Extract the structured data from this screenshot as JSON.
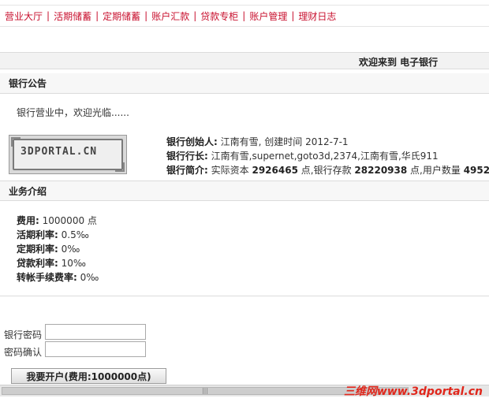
{
  "nav": {
    "items": [
      "营业大厅",
      "活期储蓄",
      "定期储蓄",
      "账户汇款",
      "贷款专柜",
      "账户管理",
      "理财日志"
    ],
    "separator": "|"
  },
  "welcome": {
    "text": "欢迎来到 电子银行"
  },
  "notice": {
    "title": "银行公告",
    "text": "银行营业中，欢迎光临......"
  },
  "logo": {
    "text": "3DPORTAL.CN"
  },
  "bank_info": {
    "founder_label": "银行创始人:",
    "founder_value": "江南有雪, 创建时间 2012-7-1",
    "president_label": "银行行长:",
    "president_value": "江南有雪,supernet,goto3d,2374,江南有雪,华氏911",
    "intro_label": "银行简介:",
    "intro_prefix": "实际资本",
    "capital": "2926465",
    "deposit_text": "点,银行存款",
    "deposit": "28220938",
    "users_text": "点,用户数量",
    "users": "4952"
  },
  "business": {
    "title": "业务介绍",
    "rows": [
      {
        "label": "费用:",
        "value": "1000000 点"
      },
      {
        "label": "活期利率:",
        "value": "0.5‰"
      },
      {
        "label": "定期利率:",
        "value": "0‰"
      },
      {
        "label": "贷款利率:",
        "value": "10‰"
      },
      {
        "label": "转帐手续费率:",
        "value": "0‰"
      }
    ]
  },
  "form": {
    "password_label": "银行密码",
    "password_value": "",
    "confirm_label": "密码确认",
    "confirm_value": "",
    "submit_label": "我要开户(费用:1000000点)"
  },
  "scrollbar": {
    "grip": "|||"
  },
  "watermark": {
    "text": "三维网www.3dportal.cn"
  }
}
